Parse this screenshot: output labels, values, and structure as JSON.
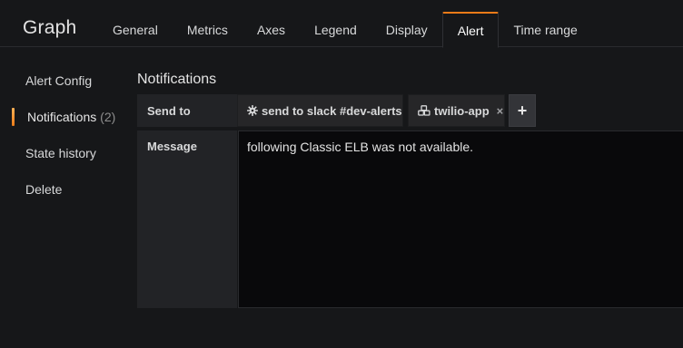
{
  "panel": {
    "title": "Graph"
  },
  "tabs": [
    {
      "label": "General"
    },
    {
      "label": "Metrics"
    },
    {
      "label": "Axes"
    },
    {
      "label": "Legend"
    },
    {
      "label": "Display"
    },
    {
      "label": "Alert",
      "active": true
    },
    {
      "label": "Time range"
    }
  ],
  "sidebar": {
    "items": [
      {
        "label": "Alert Config"
      },
      {
        "label": "Notifications",
        "count": "(2)",
        "active": true
      },
      {
        "label": "State history"
      },
      {
        "label": "Delete"
      }
    ]
  },
  "notifications": {
    "title": "Notifications",
    "send_to_label": "Send to",
    "channels": [
      {
        "label": "send to slack #dev-alerts",
        "icon": "gear-icon",
        "remove": "×"
      },
      {
        "label": "twilio-app",
        "icon": "cubes-icon",
        "remove": "×"
      }
    ],
    "add_label": "+",
    "message_label": "Message",
    "message_value": "following Classic ELB was not available."
  },
  "colors": {
    "accent": "#eb7b18",
    "background": "#161719",
    "label_bg": "#222326",
    "input_bg": "#09090b"
  }
}
